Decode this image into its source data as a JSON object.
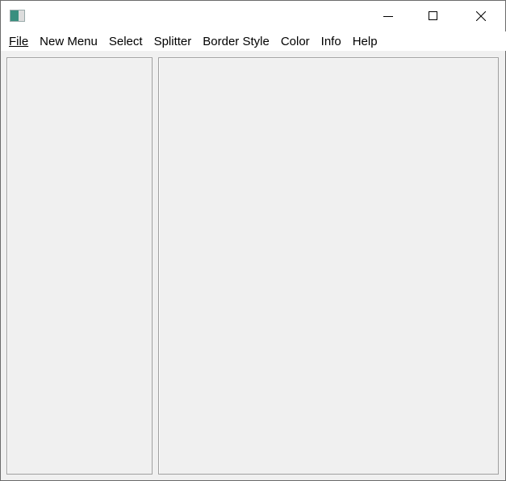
{
  "window": {
    "title": ""
  },
  "caption_buttons": {
    "minimize": "minimize-icon",
    "maximize": "maximize-icon",
    "close": "close-icon"
  },
  "menu": {
    "items": [
      {
        "label": "File"
      },
      {
        "label": "New Menu"
      },
      {
        "label": "Select"
      },
      {
        "label": "Splitter"
      },
      {
        "label": "Border Style"
      },
      {
        "label": "Color"
      },
      {
        "label": "Info"
      },
      {
        "label": "Help"
      }
    ]
  }
}
